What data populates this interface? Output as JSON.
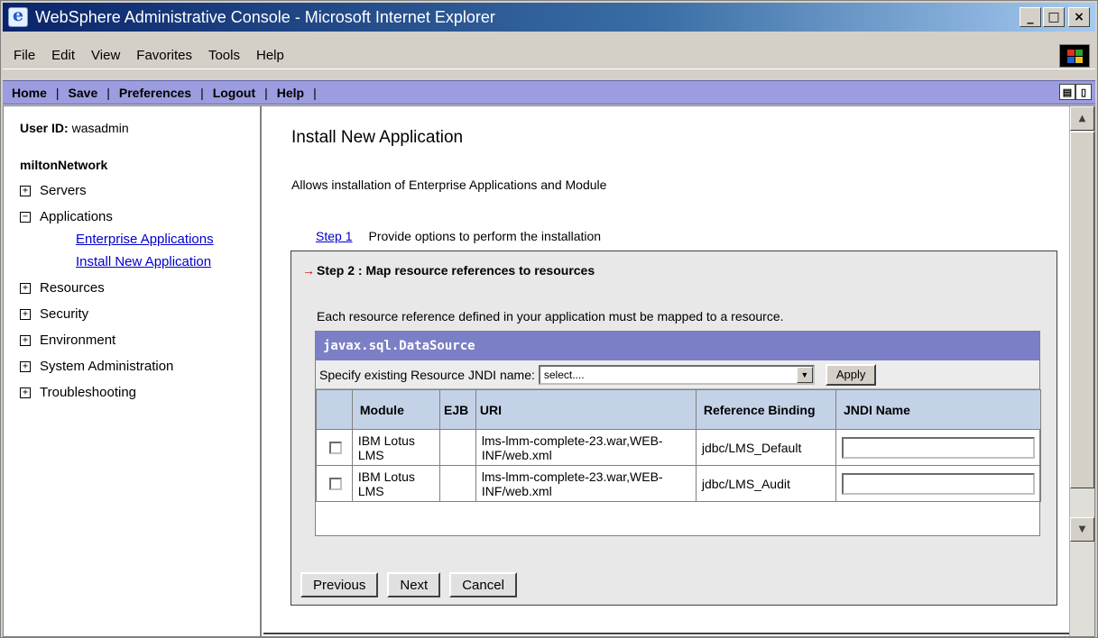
{
  "window": {
    "title": "WebSphere Administrative Console - Microsoft Internet Explorer",
    "minimize_glyph": "_",
    "maximize_glyph": "□",
    "close_glyph": "×"
  },
  "menu": [
    "File",
    "Edit",
    "View",
    "Favorites",
    "Tools",
    "Help"
  ],
  "nav": {
    "items": [
      "Home",
      "Save",
      "Preferences",
      "Logout",
      "Help"
    ],
    "separator": "|"
  },
  "sidebar": {
    "user_label": "User ID:",
    "user_value": "wasadmin",
    "cell": "miltonNetwork",
    "items": [
      {
        "label": "Servers",
        "expander": "+"
      },
      {
        "label": "Applications",
        "expander": "−"
      },
      {
        "label": "Resources",
        "expander": "+"
      },
      {
        "label": "Security",
        "expander": "+"
      },
      {
        "label": "Environment",
        "expander": "+"
      },
      {
        "label": "System Administration",
        "expander": "+"
      },
      {
        "label": "Troubleshooting",
        "expander": "+"
      }
    ],
    "sublinks": [
      "Enterprise Applications",
      "Install New Application"
    ]
  },
  "main": {
    "title": "Install New Application",
    "description": "Allows installation of Enterprise Applications and Module",
    "step1_link": "Step 1",
    "step1_text": "Provide options to perform the installation",
    "step2_title": "Step 2 :  Map resource references to resources",
    "requirement": "Each resource reference defined in your application must be mapped to a resource.",
    "ds_type": "javax.sql.DataSource",
    "spec_label": "Specify existing Resource JNDI name:",
    "select_value": "select....",
    "apply_label": "Apply",
    "columns": [
      "Module",
      "EJB",
      "URI",
      "Reference Binding",
      "JNDI Name"
    ],
    "rows": [
      {
        "module": "IBM Lotus LMS",
        "ejb": "",
        "uri": "lms-lmm-complete-23.war,WEB-INF/web.xml",
        "binding": "jdbc/LMS_Default",
        "jndi": ""
      },
      {
        "module": "IBM Lotus LMS",
        "ejb": "",
        "uri": "lms-lmm-complete-23.war,WEB-INF/web.xml",
        "binding": "jdbc/LMS_Audit",
        "jndi": ""
      }
    ],
    "buttons": {
      "previous": "Previous",
      "next": "Next",
      "cancel": "Cancel"
    }
  },
  "colors": {
    "title_bar": "#0a246a",
    "nav_bar": "#9c9ce0",
    "ds_header": "#7b7fc5",
    "table_header": "#c4d2e8",
    "link": "#0000cc"
  }
}
